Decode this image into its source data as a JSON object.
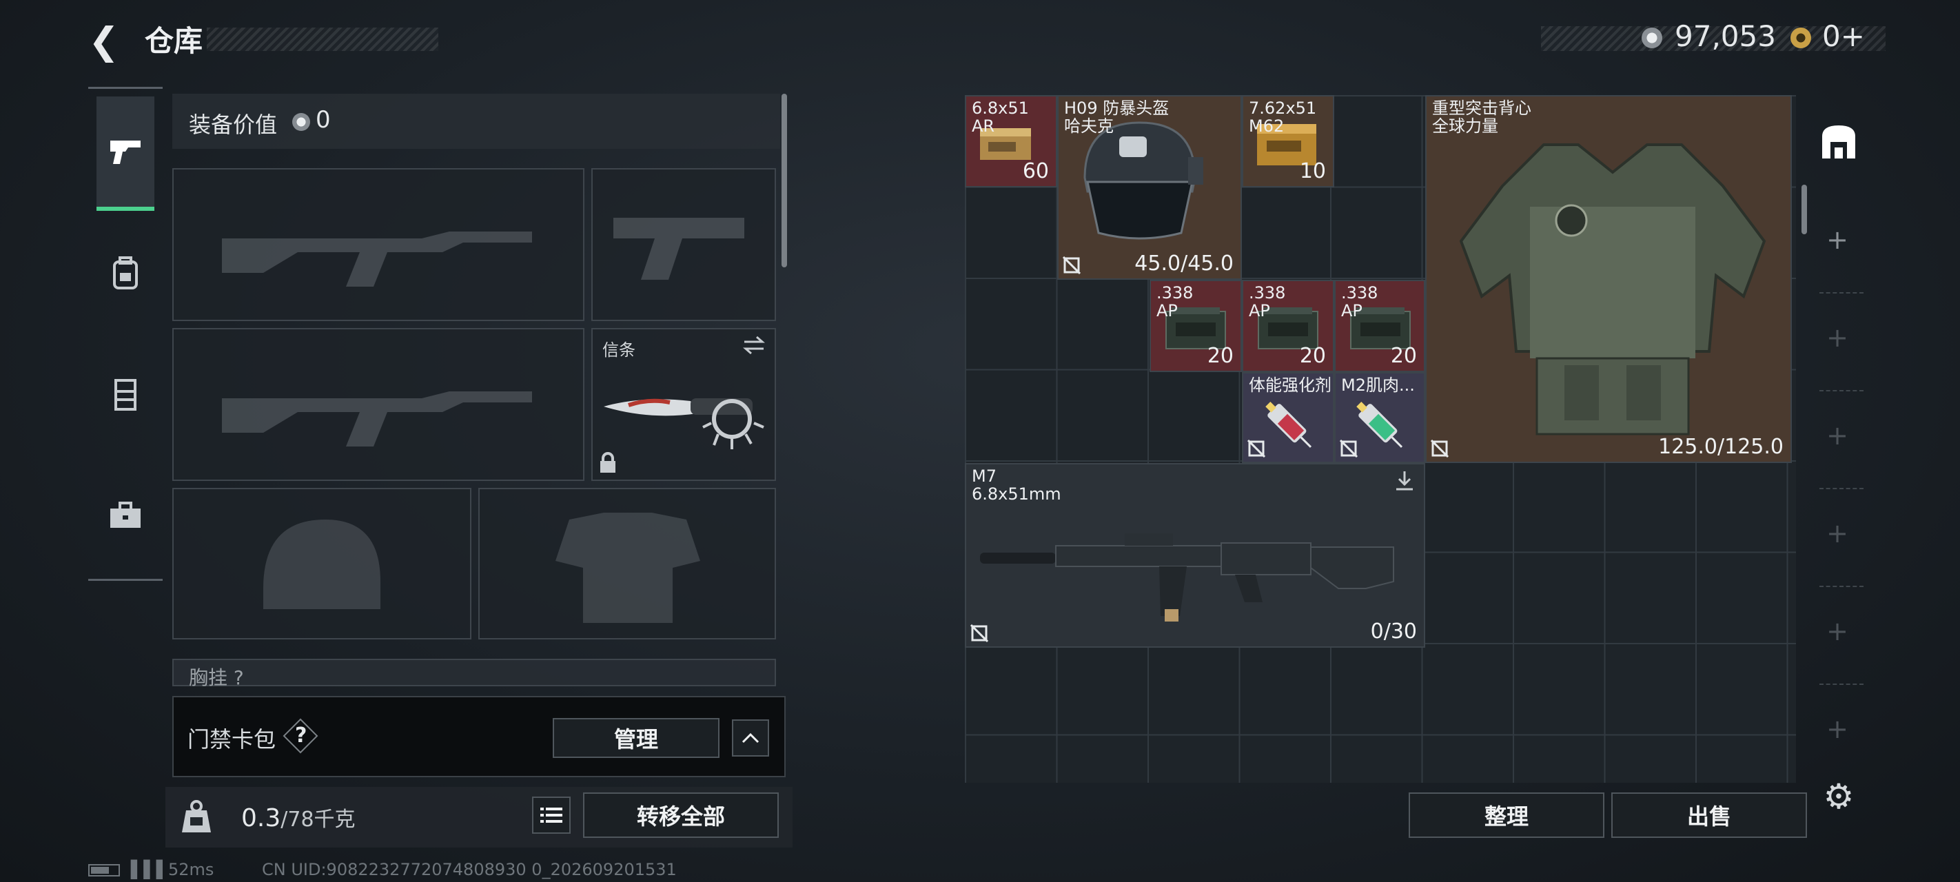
{
  "header": {
    "title": "仓库",
    "currency_primary": "97,053",
    "currency_secondary": "0+"
  },
  "nav": {
    "items": [
      "weapons-icon",
      "backpack-icon",
      "vest-icon",
      "toolbox-icon"
    ],
    "active": "weapons-icon",
    "accent_color": "#4cd08e"
  },
  "equipment": {
    "value_label": "装备价值",
    "value": "0",
    "melee_slot_title": "信条",
    "chest_rig_label": "胸挂",
    "chest_rig_hint": "?"
  },
  "keycard": {
    "label": "门禁卡包",
    "help": "?",
    "manage_label": "管理",
    "collapse_icon": "chevron-up-icon"
  },
  "weight": {
    "value": "0.3",
    "max": "/78千克",
    "transfer_label": "转移全部"
  },
  "status": {
    "ping": "52ms",
    "uid": "CN UID:9082232772074808930 0_202609201531"
  },
  "stash": {
    "items": [
      {
        "label": "6.8x51\nAR",
        "count": "60"
      },
      {
        "label": "H09 防暴头盔\n哈夫克",
        "durability": "45.0/45.0"
      },
      {
        "label": "7.62x51\nM62",
        "count": "10"
      },
      {
        "label": "重型突击背心\n全球力量",
        "durability": "125.0/125.0"
      },
      {
        "label": ".338\nAP",
        "count": "20"
      },
      {
        "label": ".338\nAP",
        "count": "20"
      },
      {
        "label": ".338\nAP",
        "count": "20"
      },
      {
        "label": "体能强化剂"
      },
      {
        "label": "M2肌肉..."
      },
      {
        "label": "M7\n6.8x51mm",
        "ammo": "0/30"
      }
    ],
    "sort_label": "整理",
    "sell_label": "出售"
  }
}
